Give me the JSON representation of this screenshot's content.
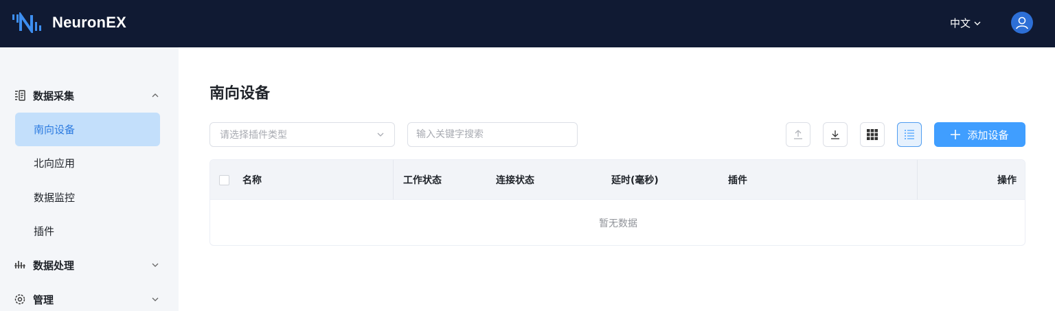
{
  "header": {
    "brand": "NeuronEX",
    "language": "中文"
  },
  "sidebar": {
    "groups": [
      {
        "label": "数据采集",
        "icon": "data-collection-icon",
        "expanded": true,
        "items": [
          {
            "label": "南向设备",
            "active": true
          },
          {
            "label": "北向应用",
            "active": false
          },
          {
            "label": "数据监控",
            "active": false
          },
          {
            "label": "插件",
            "active": false
          }
        ]
      },
      {
        "label": "数据处理",
        "icon": "data-processing-icon",
        "expanded": false
      },
      {
        "label": "管理",
        "icon": "gear-icon",
        "expanded": false
      }
    ]
  },
  "main": {
    "title": "南向设备",
    "plugin_select": {
      "placeholder": "请选择插件类型"
    },
    "search": {
      "placeholder": "输入关键字搜索"
    },
    "add_button": "添加设备",
    "table": {
      "columns": [
        "名称",
        "工作状态",
        "连接状态",
        "延时(毫秒)",
        "插件",
        "操作"
      ],
      "empty_text": "暂无数据"
    }
  },
  "colors": {
    "topbar": "#101a33",
    "accent": "#409eff",
    "active_item_bg": "#c3dffb",
    "sidebar_bg": "#f4f6f9"
  }
}
